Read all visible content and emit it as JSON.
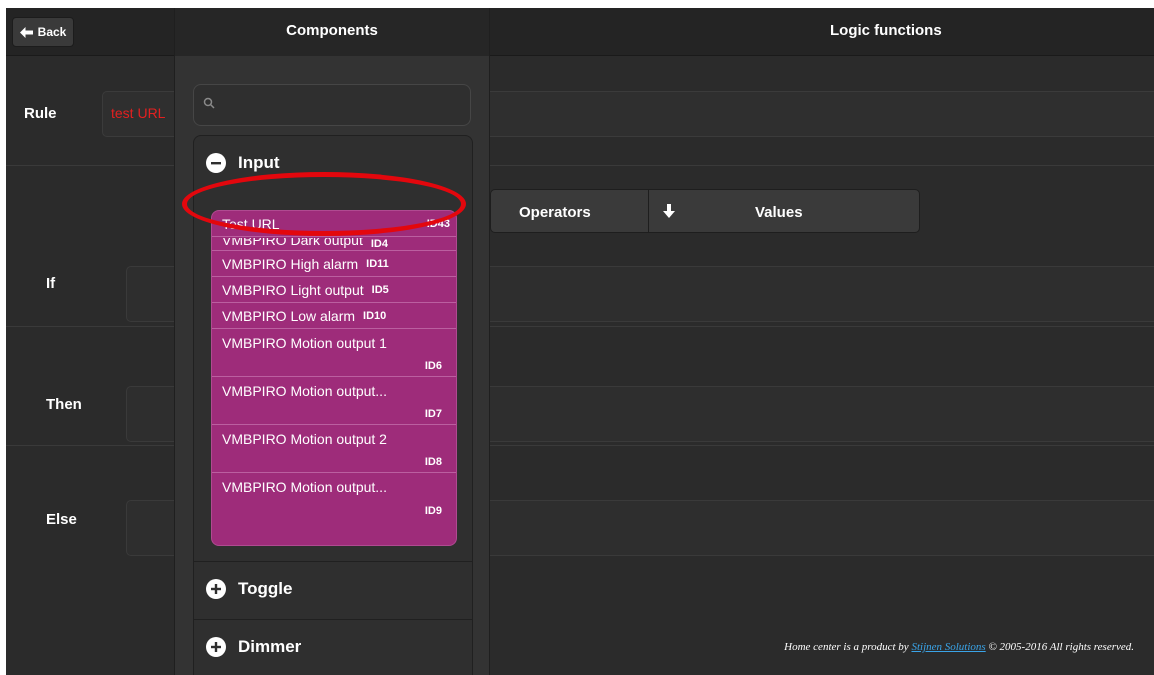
{
  "header": {
    "back_label": "Back",
    "components_title": "Components",
    "logic_title": "Logic functions"
  },
  "rule": {
    "label": "Rule",
    "value": "test URL"
  },
  "operators_bar": {
    "operators_label": "Operators",
    "values_label": "Values"
  },
  "conditions": {
    "if_label": "If",
    "then_label": "Then",
    "else_label": "Else"
  },
  "components": {
    "search_placeholder": "",
    "sections": [
      {
        "title": "Input",
        "expanded": true,
        "items": [
          {
            "label": "Test URL",
            "id": "ID43"
          },
          {
            "label": "VMBPIRO Dark output",
            "id": "ID4"
          },
          {
            "label": "VMBPIRO High alarm",
            "id": "ID11"
          },
          {
            "label": "VMBPIRO Light output",
            "id": "ID5"
          },
          {
            "label": "VMBPIRO Low alarm",
            "id": "ID10"
          },
          {
            "label": "VMBPIRO Motion output 1",
            "id": "ID6"
          },
          {
            "label": "VMBPIRO Motion output...",
            "id": "ID7"
          },
          {
            "label": "VMBPIRO Motion output 2",
            "id": "ID8"
          },
          {
            "label": "VMBPIRO Motion output...",
            "id": "ID9"
          }
        ]
      },
      {
        "title": "Toggle",
        "expanded": false
      },
      {
        "title": "Dimmer",
        "expanded": false
      }
    ]
  },
  "footer": {
    "prefix": "Home center is a product by",
    "company": "Stijnen Solutions",
    "suffix": "© 2005-2016 All rights reserved."
  },
  "colors": {
    "item_background": "#9e2c7a",
    "rule_text": "#e32020",
    "highlight": "#e3070d",
    "footer_link": "#3aa4e8"
  }
}
